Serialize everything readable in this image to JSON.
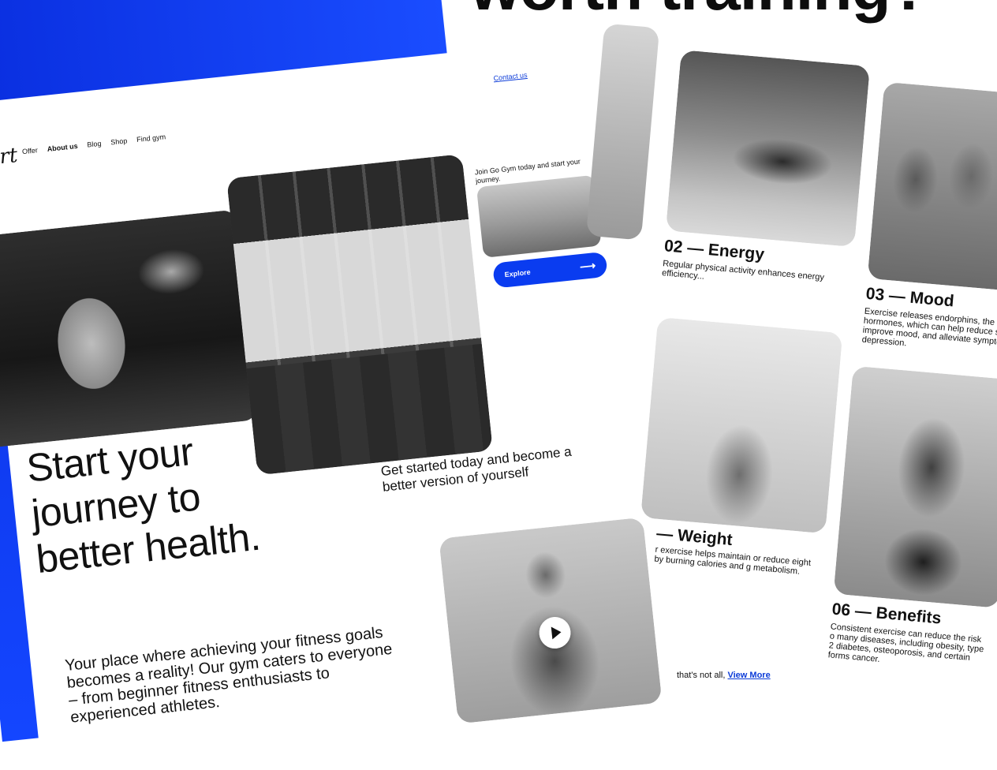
{
  "hero_top": {
    "heading": "worth training?"
  },
  "nav": {
    "logo": "Art",
    "items": [
      "Offer",
      "About us",
      "Blog",
      "Shop",
      "Find gym"
    ],
    "active": "About us",
    "contact": "Contact us"
  },
  "hero": {
    "title_lines": [
      "Start your",
      "journey to",
      "better health."
    ],
    "subtitle": "Get started today and become a better version of yourself",
    "join_text": "Join Go Gym today and start your journey.",
    "explore_label": "Explore",
    "intro": "Your place where achieving your fitness goals becomes a reality! Our gym caters to everyone – from beginner fitness enthusiasts to experienced athletes."
  },
  "benefits": [
    {
      "title": "02 — Energy",
      "text": "Regular physical activity enhances energy efficiency..."
    },
    {
      "title": "03 — Mood",
      "text": "Exercise releases endorphins, the fe hormones, which can help reduce st improve mood, and alleviate sympto depression."
    },
    {
      "title": "— Weight",
      "text": "r exercise helps maintain or reduce eight by burning calories and g metabolism."
    },
    {
      "title": "06 — Benefits",
      "text": "Consistent exercise can reduce the risk o many diseases, including obesity, type 2 diabetes, osteoporosis, and certain forms cancer."
    }
  ],
  "footer_more": {
    "prefix": "that's not all,",
    "link": "View More"
  },
  "colors": {
    "accent": "#0a3cf0",
    "link": "#0b3bd8"
  }
}
